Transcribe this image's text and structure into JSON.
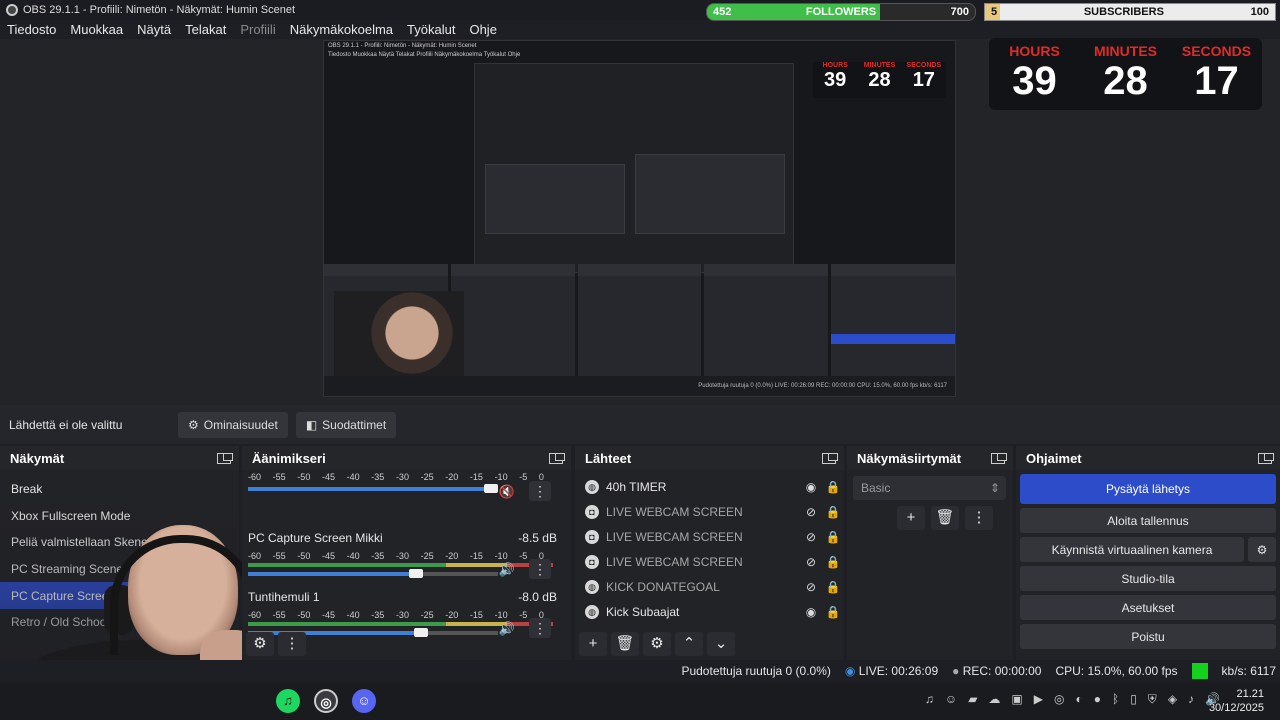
{
  "titlebar": {
    "title": "OBS 29.1.1 - Profiili: Nimetön - Näkymät: Humin Scenet"
  },
  "menu": [
    "Tiedosto",
    "Muokkaa",
    "Näytä",
    "Telakat",
    "Profiili",
    "Näkymäkokoelma",
    "Työkalut",
    "Ohje"
  ],
  "followers": {
    "label": "FOLLOWERS",
    "current": "452",
    "goal": "700",
    "fill_fraction": 0.646
  },
  "subscribers": {
    "label": "SUBSCRIBERS",
    "current": "5",
    "goal": "100",
    "fill_fraction": 0.05
  },
  "timer": {
    "hours_label": "HOURS",
    "minutes_label": "MINUTES",
    "seconds_label": "SECONDS",
    "hours": "39",
    "minutes": "28",
    "seconds": "17"
  },
  "preview": {
    "nested_title": "OBS 29.1.1 - Profiili: Nimetön - Näkymät: Humin Scenet",
    "nested_menu": "Tiedosto  Muokkaa  Näytä  Telakat  Profiili  Näkymäkokoelma  Työkalut  Ohje",
    "nested_status": "Pudotettuja ruutuja 0 (0.0%)   LIVE: 00:26:09   REC: 00:00:00   CPU: 15.0%, 60.00 fps   kb/s: 6117"
  },
  "properties_bar": {
    "no_source": "Lähdettä ei ole valittu",
    "properties": "Ominaisuudet",
    "filters": "Suodattimet"
  },
  "scenes": {
    "title": "Näkymät",
    "items": [
      "Break",
      "Xbox Fullscreen Mode",
      "Peliä valmistellaan Skene",
      "PC Streaming Scene",
      "PC Capture Screen",
      "Retro / Old School"
    ],
    "active_index": 4
  },
  "mixer": {
    "title": "Äänimikseri",
    "ticks": [
      "-60",
      "-55",
      "-50",
      "-45",
      "-40",
      "-35",
      "-30",
      "-25",
      "-20",
      "-15",
      "-10",
      "-5",
      "0"
    ],
    "tracks": [
      {
        "name": "",
        "db": "",
        "volume_fraction": 0.97,
        "muted": true
      },
      {
        "name": "PC Capture Screen Mikki",
        "db": "-8.5 dB",
        "volume_fraction": 0.67,
        "muted": false
      },
      {
        "name": "Tuntihemuli 1",
        "db": "-8.0 dB",
        "volume_fraction": 0.69,
        "muted": false
      }
    ]
  },
  "sources": {
    "title": "Lähteet",
    "items": [
      {
        "name": "40h TIMER",
        "visible": true,
        "icon": "globe-icon"
      },
      {
        "name": "LIVE WEBCAM SCREEN",
        "visible": false,
        "icon": "camera-icon"
      },
      {
        "name": "LIVE WEBCAM SCREEN",
        "visible": false,
        "icon": "camera-icon"
      },
      {
        "name": "LIVE WEBCAM SCREEN",
        "visible": false,
        "icon": "camera-icon"
      },
      {
        "name": "KICK DONATEGOAL",
        "visible": false,
        "icon": "globe-icon"
      },
      {
        "name": "Kick Subaajat",
        "visible": true,
        "icon": "globe-icon"
      }
    ]
  },
  "transitions": {
    "title": "Näkymäsiirtymät",
    "selected": "Basic"
  },
  "controls": {
    "title": "Ohjaimet",
    "stop_stream": "Pysäytä lähetys",
    "start_record": "Aloita tallennus",
    "virtual_cam": "Käynnistä virtuaalinen kamera",
    "studio_mode": "Studio-tila",
    "settings": "Asetukset",
    "exit": "Poistu"
  },
  "status": {
    "dropped": "Pudotettuja ruutuja 0 (0.0%)",
    "live": "LIVE: 00:26:09",
    "rec": "REC: 00:00:00",
    "cpu": "CPU: 15.0%, 60.00 fps",
    "kbps": "kb/s: 6117"
  },
  "clock": {
    "time": "21.21",
    "date": "30/12/2025"
  },
  "colors": {
    "accent": "#2d4cc9",
    "live_green": "#14d11e",
    "timer_red": "#e12b2b",
    "followers_green": "#3fbf4a"
  }
}
